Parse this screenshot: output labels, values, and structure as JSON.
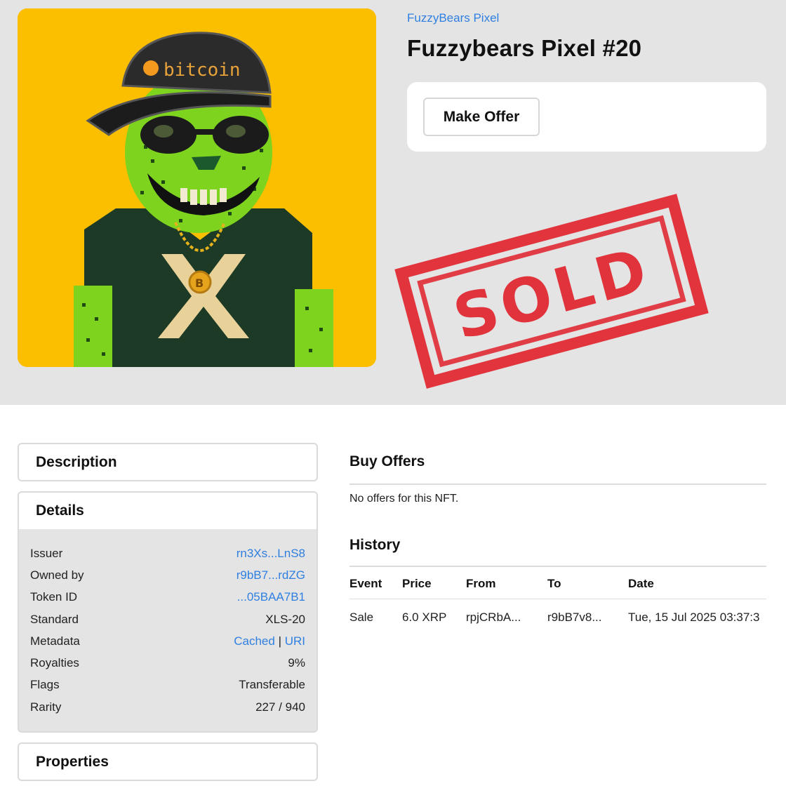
{
  "hero": {
    "collection_link": "FuzzyBears Pixel",
    "title": "Fuzzybears Pixel #20",
    "make_offer_label": "Make Offer",
    "image_cap_text": "bitcoin",
    "image_medallion_text": "B",
    "stamp_text": "SOLD",
    "colors": {
      "background": "#fbbf00",
      "fur": "#7ed31f",
      "shirt": "#1c3a26",
      "cap": "#2b2b2b",
      "stamp": "#e0202a"
    }
  },
  "description": {
    "header": "Description"
  },
  "details": {
    "header": "Details",
    "rows": [
      {
        "label": "Issuer",
        "value": "rn3Xs...LnS8",
        "link": true
      },
      {
        "label": "Owned by",
        "value": "r9bB7...rdZG",
        "link": true
      },
      {
        "label": "Token ID",
        "value": "...05BAA7B1",
        "link": true
      },
      {
        "label": "Standard",
        "value": "XLS-20",
        "link": false
      },
      {
        "label": "Metadata",
        "value_a": "Cached",
        "sep": "|",
        "value_b": "URI"
      },
      {
        "label": "Royalties",
        "value": "9%",
        "link": false
      },
      {
        "label": "Flags",
        "value": "Transferable",
        "link": false
      },
      {
        "label": "Rarity",
        "value": "227 / 940",
        "link": false
      }
    ]
  },
  "properties": {
    "header": "Properties"
  },
  "buy_offers": {
    "header": "Buy Offers",
    "empty_text": "No offers for this NFT."
  },
  "history": {
    "header": "History",
    "columns": [
      "Event",
      "Price",
      "From",
      "To",
      "Date"
    ],
    "rows": [
      {
        "event": "Sale",
        "price": "6.0 XRP",
        "from": "rpjCRbA...",
        "to": "r9bB7v8...",
        "date": "Tue, 15 Jul 2025 03:37:3"
      }
    ]
  }
}
